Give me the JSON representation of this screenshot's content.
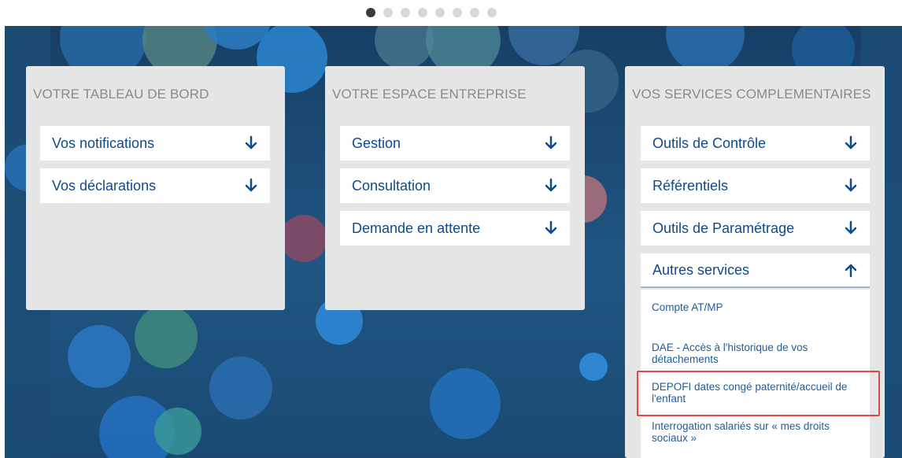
{
  "carousel": {
    "total_dots": 8,
    "active_index": 0
  },
  "colors": {
    "banner_bg": "#1a4a72",
    "card_bg": "#e6e6e6",
    "link_blue": "#0e4a8c",
    "highlight_red": "#e04848"
  },
  "cards": [
    {
      "title": "VOTRE TABLEAU DE BORD",
      "items": [
        {
          "label": "Vos notifications",
          "arrow": "down"
        },
        {
          "label": "Vos déclarations",
          "arrow": "down"
        }
      ]
    },
    {
      "title": "VOTRE ESPACE ENTREPRISE",
      "items": [
        {
          "label": "Gestion",
          "arrow": "down"
        },
        {
          "label": "Consultation",
          "arrow": "down"
        },
        {
          "label": "Demande en attente",
          "arrow": "down"
        }
      ]
    },
    {
      "title": "VOS SERVICES COMPLEMENTAIRES",
      "items": [
        {
          "label": "Outils de Contrôle",
          "arrow": "down"
        },
        {
          "label": "Référentiels",
          "arrow": "down"
        },
        {
          "label": "Outils de Paramétrage",
          "arrow": "down"
        },
        {
          "label": "Autres services",
          "arrow": "up"
        }
      ],
      "submenu": [
        {
          "label": "Compte AT/MP"
        },
        {
          "label": "DAE - Accès à l'historique de vos détachements"
        },
        {
          "label": "DEPOFI dates congé paternité/accueil de l'enfant",
          "highlighted": true
        },
        {
          "label": "Interrogation salariés sur « mes droits sociaux »"
        }
      ]
    }
  ]
}
